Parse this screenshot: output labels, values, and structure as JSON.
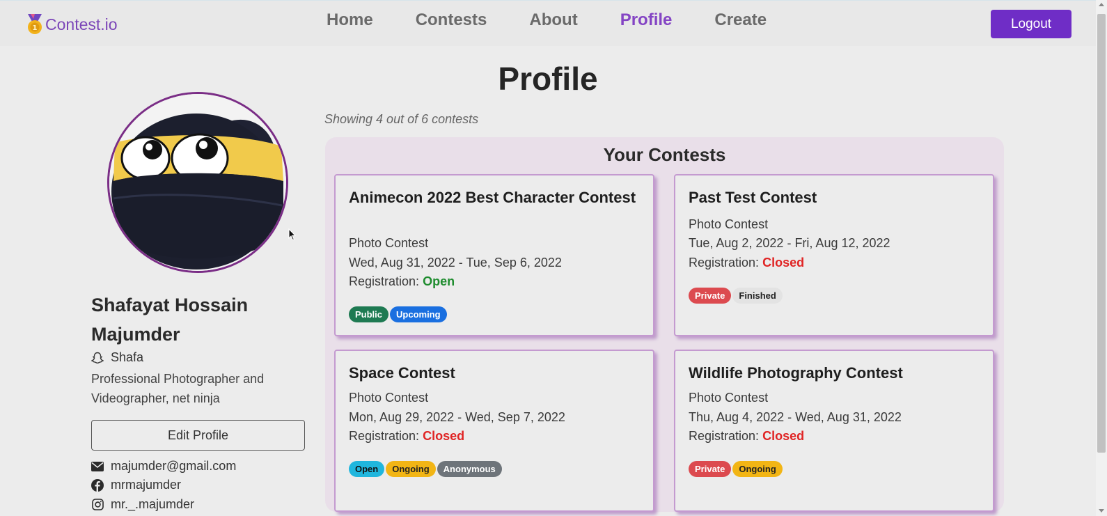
{
  "nav": {
    "brand": "Contest.io",
    "links": [
      "Home",
      "Contests",
      "About",
      "Profile",
      "Create"
    ],
    "active": "Profile",
    "logout": "Logout"
  },
  "page": {
    "title": "Profile"
  },
  "profile": {
    "name": "Shafayat Hossain Majumder",
    "username": "Shafa",
    "bio": "Professional Photographer and Videographer, net ninja",
    "edit_label": "Edit Profile",
    "email": "majumder@gmail.com",
    "facebook": "mrmajumder",
    "instagram": "mr._.majumder"
  },
  "contests": {
    "showing": "Showing 4 out of 6 contests",
    "panel_title": "Your Contests",
    "registration_label": "Registration:",
    "cards": [
      {
        "title": "Animecon 2022 Best Character Contest",
        "type": "Photo Contest",
        "dates": "Wed, Aug 31, 2022 - Tue, Sep 6, 2022",
        "registration": "Open",
        "badges": [
          "Public",
          "Upcoming"
        ]
      },
      {
        "title": "Past Test Contest",
        "type": "Photo Contest",
        "dates": "Tue, Aug 2, 2022 - Fri, Aug 12, 2022",
        "registration": "Closed",
        "badges": [
          "Private",
          "Finished"
        ]
      },
      {
        "title": "Space Contest",
        "type": "Photo Contest",
        "dates": "Mon, Aug 29, 2022 - Wed, Sep 7, 2022",
        "registration": "Closed",
        "badges": [
          "Open",
          "Ongoing",
          "Anonymous"
        ]
      },
      {
        "title": "Wildlife Photography Contest",
        "type": "Photo Contest",
        "dates": "Thu, Aug 4, 2022 - Wed, Aug 31, 2022",
        "registration": "Closed",
        "badges": [
          "Private",
          "Ongoing"
        ]
      }
    ]
  },
  "colors": {
    "brand": "#7b45b8",
    "nav_active": "#8444c4",
    "logout_bg": "#6f2dc6",
    "status_open": "#1e8c2e",
    "status_closed": "#e02424"
  },
  "icons": [
    "medal-icon",
    "snapchat-icon",
    "envelope-icon",
    "facebook-icon",
    "instagram-icon",
    "mouse-cursor-icon"
  ]
}
